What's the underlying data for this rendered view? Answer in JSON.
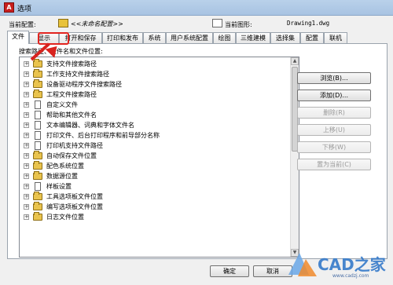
{
  "window": {
    "title": "选项",
    "icon_letter": "A"
  },
  "header": {
    "profile_label": "当前配置:",
    "profile_value": "<<未命名配置>>",
    "drawing_label": "当前图形:",
    "drawing_value": "Drawing1.dwg"
  },
  "tabs": [
    {
      "label": "文件",
      "active": true
    },
    {
      "label": "显示",
      "active": false
    },
    {
      "label": "打开和保存",
      "active": false
    },
    {
      "label": "打印和发布",
      "active": false
    },
    {
      "label": "系统",
      "active": false
    },
    {
      "label": "用户系统配置",
      "active": false
    },
    {
      "label": "绘图",
      "active": false
    },
    {
      "label": "三维建模",
      "active": false
    },
    {
      "label": "选择集",
      "active": false
    },
    {
      "label": "配置",
      "active": false
    },
    {
      "label": "联机",
      "active": false
    }
  ],
  "panel": {
    "label": "搜索路径、文件名和文件位置:"
  },
  "tree_items": [
    {
      "label": "支持文件搜索路径",
      "icon": "folder"
    },
    {
      "label": "工作支持文件搜索路径",
      "icon": "folder"
    },
    {
      "label": "设备驱动程序文件搜索路径",
      "icon": "folder"
    },
    {
      "label": "工程文件搜索路径",
      "icon": "folder-doc"
    },
    {
      "label": "自定义文件",
      "icon": "document"
    },
    {
      "label": "帮助和其他文件名",
      "icon": "document"
    },
    {
      "label": "文本编辑器、词典和字体文件名",
      "icon": "document"
    },
    {
      "label": "打印文件、后台打印程序和前导部分名称",
      "icon": "document"
    },
    {
      "label": "打印机支持文件路径",
      "icon": "document"
    },
    {
      "label": "自动保存文件位置",
      "icon": "folder"
    },
    {
      "label": "配色系统位置",
      "icon": "folder"
    },
    {
      "label": "数据源位置",
      "icon": "folder"
    },
    {
      "label": "样板设置",
      "icon": "document"
    },
    {
      "label": "工具选项板文件位置",
      "icon": "folder"
    },
    {
      "label": "编写选项板文件位置",
      "icon": "folder"
    },
    {
      "label": "日志文件位置",
      "icon": "folder"
    }
  ],
  "side_buttons": [
    {
      "label": "浏览(B)...",
      "enabled": true
    },
    {
      "label": "添加(D)...",
      "enabled": true
    },
    {
      "label": "删除(R)",
      "enabled": false
    },
    {
      "label": "上移(U)",
      "enabled": false
    },
    {
      "label": "下移(W)",
      "enabled": false
    },
    {
      "label": "置为当前(C)",
      "enabled": false
    }
  ],
  "footer": {
    "ok_label": "确定",
    "cancel_label": "取消"
  },
  "annotation": {
    "highlight_color": "#e2241f",
    "target_tab": "显示"
  },
  "watermark": {
    "text": "CAD之家",
    "url": "www.cadzj.com"
  }
}
